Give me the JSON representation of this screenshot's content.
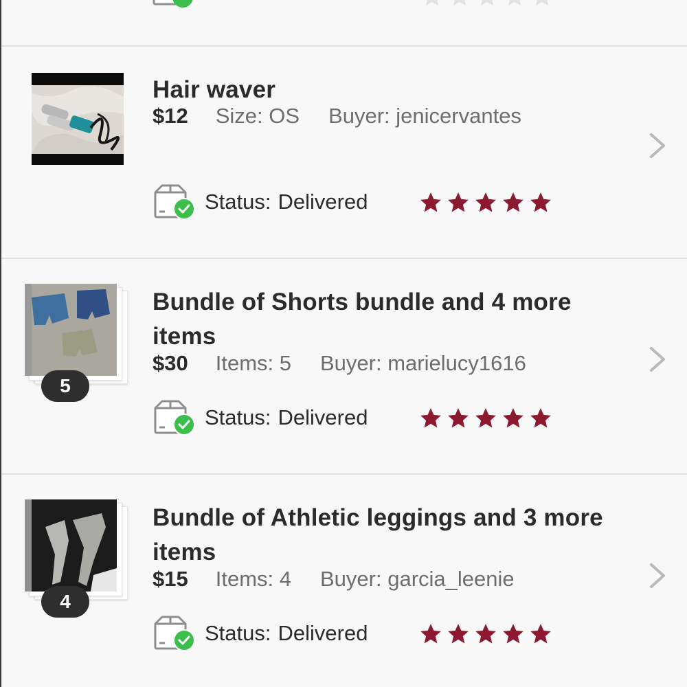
{
  "accent_star_color": "#8b1a30",
  "status_check_color": "#3cbf4a",
  "orders": [
    {
      "title": "Hair waver",
      "price": "$12",
      "detail": "Size: OS",
      "buyer": "Buyer: jenicervantes",
      "status_label": "Status:",
      "status_value": "Delivered",
      "rating": 5,
      "bundle_count": null
    },
    {
      "title": "Bundle of Shorts bundle and 4 more items",
      "price": "$30",
      "detail": "Items: 5",
      "buyer": "Buyer: marielucy1616",
      "status_label": "Status:",
      "status_value": "Delivered",
      "rating": 5,
      "bundle_count": "5"
    },
    {
      "title": "Bundle of Athletic leggings and 3 more items",
      "price": "$15",
      "detail": "Items: 4",
      "buyer": "Buyer: garcia_leenie",
      "status_label": "Status:",
      "status_value": "Delivered",
      "rating": 5,
      "bundle_count": "4"
    }
  ]
}
